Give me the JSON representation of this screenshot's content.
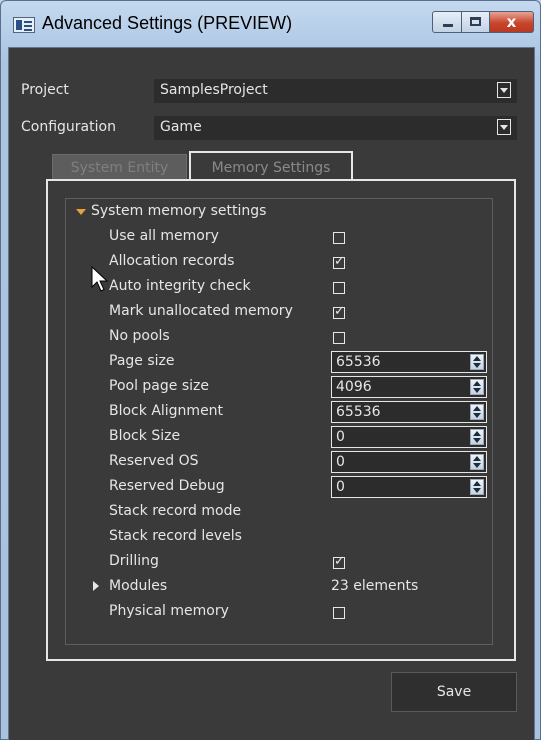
{
  "window": {
    "title": "Advanced Settings (PREVIEW)",
    "close_glyph": "x"
  },
  "project": {
    "label": "Project",
    "value": "SamplesProject"
  },
  "configuration": {
    "label": "Configuration",
    "value": "Game"
  },
  "tabs": [
    {
      "label": "System Entity",
      "active": false
    },
    {
      "label": "Memory Settings",
      "active": true
    }
  ],
  "group": {
    "title": "System memory settings",
    "properties": {
      "use_all_memory": {
        "label": "Use all memory",
        "checked": false
      },
      "allocation_records": {
        "label": "Allocation records",
        "checked": true
      },
      "auto_integrity_check": {
        "label": "Auto integrity check",
        "checked": false
      },
      "mark_unallocated_memory": {
        "label": "Mark unallocated memory",
        "checked": true
      },
      "no_pools": {
        "label": "No pools",
        "checked": false
      },
      "page_size": {
        "label": "Page size",
        "value": "65536"
      },
      "pool_page_size": {
        "label": "Pool page size",
        "value": "4096"
      },
      "block_alignment": {
        "label": "Block Alignment",
        "value": "65536"
      },
      "block_size": {
        "label": "Block Size",
        "value": "0"
      },
      "reserved_os": {
        "label": "Reserved OS",
        "value": "0"
      },
      "reserved_debug": {
        "label": "Reserved Debug",
        "value": "0"
      },
      "stack_record_mode": {
        "label": "Stack record mode"
      },
      "stack_record_levels": {
        "label": "Stack record levels"
      },
      "drilling": {
        "label": "Drilling",
        "checked": true
      },
      "modules": {
        "label": "Modules",
        "value": "23 elements"
      },
      "physical_memory": {
        "label": "Physical memory",
        "checked": false
      }
    }
  },
  "save_button": {
    "label": "Save"
  },
  "colors": {
    "background": "#3a3a3a",
    "text": "#e6e6e6",
    "accent_arrow": "#e8a13a",
    "close_button": "#c9452b"
  }
}
